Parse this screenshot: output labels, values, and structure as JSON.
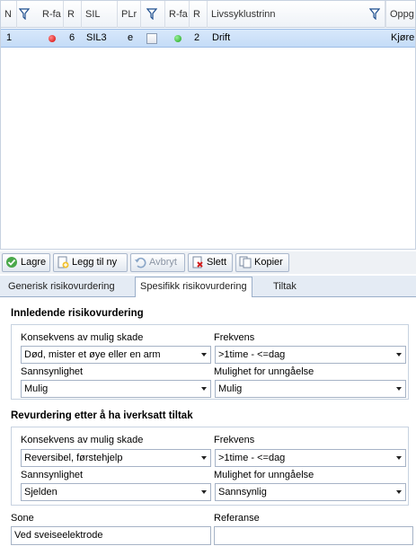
{
  "grid": {
    "columns": [
      "N",
      "R-fa",
      "R",
      "SIL",
      "PLr",
      "R-fa",
      "R",
      "Livssyklustrinn",
      "Oppg"
    ],
    "row": {
      "n": "1",
      "r1": "6",
      "sil": "SIL3",
      "plr": "e",
      "r2": "2",
      "livssyklus": "Drift",
      "oppg": "Kjøre"
    },
    "status_colors": {
      "red": "#d40000",
      "green": "#1aa21a"
    }
  },
  "toolbar": {
    "save": "Lagre",
    "add_new": "Legg til ny",
    "cancel": "Avbryt",
    "delete": "Slett",
    "copy": "Kopier"
  },
  "tabs": [
    "Generisk risikovurdering",
    "Spesifikk risikovurdering",
    "Tiltak"
  ],
  "active_tab": "Spesifikk risikovurdering",
  "initial": {
    "title": "Innledende risikovurdering",
    "konsekvens_label": "Konsekvens av mulig skade",
    "konsekvens_value": "Død, mister et øye eller en arm",
    "frekvens_label": "Frekvens",
    "frekvens_value": ">1time - <=dag",
    "sannsynlighet_label": "Sannsynlighet",
    "sannsynlighet_value": "Mulig",
    "unngaelse_label": "Mulighet for unngåelse",
    "unngaelse_value": "Mulig"
  },
  "revised": {
    "title": "Revurdering etter å  ha iverksatt tiltak",
    "konsekvens_label": "Konsekvens av mulig skade",
    "konsekvens_value": "Reversibel, førstehjelp",
    "frekvens_label": "Frekvens",
    "frekvens_value": ">1time - <=dag",
    "sannsynlighet_label": "Sannsynlighet",
    "sannsynlighet_value": "Sjelden",
    "unngaelse_label": "Mulighet for unngåelse",
    "unngaelse_value": "Sannsynlig"
  },
  "sone": {
    "label": "Sone",
    "value": "Ved sveiseelektrode"
  },
  "referanse": {
    "label": "Referanse",
    "value": ""
  }
}
